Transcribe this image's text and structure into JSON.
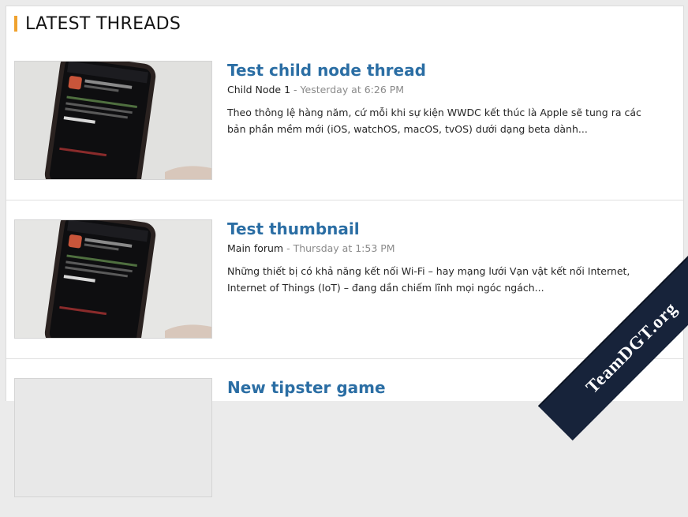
{
  "section": {
    "title": "LATEST THREADS",
    "accent_color": "#f0a22e"
  },
  "threads": [
    {
      "title": "Test child node thread",
      "forum": "Child Node 1",
      "separator": " - ",
      "time": "Yesterday at 6:26 PM",
      "excerpt": "Theo thông lệ hàng năm, cứ mỗi khi sự kiện WWDC kết thúc là Apple sẽ tung ra các bản phần mềm mới (iOS, watchOS, macOS, tvOS) dưới dạng beta dành...",
      "thumbnail": "phone-install-profile-photo"
    },
    {
      "title": "Test thumbnail",
      "forum": "Main forum",
      "separator": " - ",
      "time": "Thursday at 1:53 PM",
      "excerpt": "Những thiết bị có khả năng kết nối Wi-Fi – hay mạng lưới Vạn vật kết nối Internet, Internet of Things (IoT) – đang dần chiếm lĩnh mọi ngóc ngách...",
      "thumbnail": "phone-install-profile-photo"
    },
    {
      "title": "New tipster game",
      "thumbnail": "placeholder"
    }
  ],
  "watermark": {
    "text": "TeamDGT.org",
    "background": "#17233a"
  },
  "colors": {
    "link": "#2b6ea4",
    "meta": "#8a8a8a",
    "text": "#262626"
  }
}
